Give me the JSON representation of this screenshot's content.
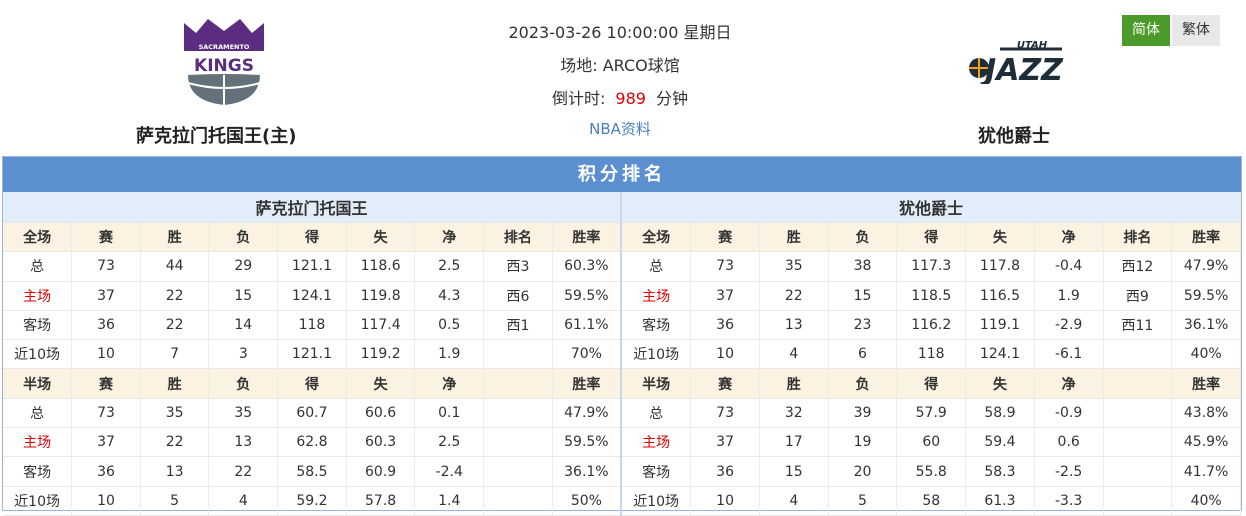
{
  "match": {
    "datetime": "2023-03-26 10:00:00 星期日",
    "venue_label": "场地:",
    "venue": "ARCO球馆",
    "countdown_label": "倒计时:",
    "countdown_value": "989",
    "countdown_unit": "分钟",
    "info_link": "NBA资料"
  },
  "home": {
    "name": "萨克拉门托国王(主)",
    "logo_text_top": "SACRAMENTO",
    "logo_text_main": "KINGS"
  },
  "away": {
    "name": "犹他爵士",
    "logo_text_top": "UTAH",
    "logo_text_main": "JAZZ"
  },
  "lang": {
    "simplified": "简体",
    "traditional": "繁体"
  },
  "panel_title": "积分排名",
  "tables": [
    {
      "team": "萨克拉门托国王",
      "rows": [
        [
          "全场",
          "赛",
          "胜",
          "负",
          "得",
          "失",
          "净",
          "排名",
          "胜率"
        ],
        [
          "总",
          "73",
          "44",
          "29",
          "121.1",
          "118.6",
          "2.5",
          "西3",
          "60.3%"
        ],
        [
          "主场",
          "37",
          "22",
          "15",
          "124.1",
          "119.8",
          "4.3",
          "西6",
          "59.5%"
        ],
        [
          "客场",
          "36",
          "22",
          "14",
          "118",
          "117.4",
          "0.5",
          "西1",
          "61.1%"
        ],
        [
          "近10场",
          "10",
          "7",
          "3",
          "121.1",
          "119.2",
          "1.9",
          "",
          "70%"
        ],
        [
          "半场",
          "赛",
          "胜",
          "负",
          "得",
          "失",
          "净",
          "",
          "胜率"
        ],
        [
          "总",
          "73",
          "35",
          "35",
          "60.7",
          "60.6",
          "0.1",
          "",
          "47.9%"
        ],
        [
          "主场",
          "37",
          "22",
          "13",
          "62.8",
          "60.3",
          "2.5",
          "",
          "59.5%"
        ],
        [
          "客场",
          "36",
          "13",
          "22",
          "58.5",
          "60.9",
          "-2.4",
          "",
          "36.1%"
        ],
        [
          "近10场",
          "10",
          "5",
          "4",
          "59.2",
          "57.8",
          "1.4",
          "",
          "50%"
        ]
      ]
    },
    {
      "team": "犹他爵士",
      "rows": [
        [
          "全场",
          "赛",
          "胜",
          "负",
          "得",
          "失",
          "净",
          "排名",
          "胜率"
        ],
        [
          "总",
          "73",
          "35",
          "38",
          "117.3",
          "117.8",
          "-0.4",
          "西12",
          "47.9%"
        ],
        [
          "主场",
          "37",
          "22",
          "15",
          "118.5",
          "116.5",
          "1.9",
          "西9",
          "59.5%"
        ],
        [
          "客场",
          "36",
          "13",
          "23",
          "116.2",
          "119.1",
          "-2.9",
          "西11",
          "36.1%"
        ],
        [
          "近10场",
          "10",
          "4",
          "6",
          "118",
          "124.1",
          "-6.1",
          "",
          "40%"
        ],
        [
          "半场",
          "赛",
          "胜",
          "负",
          "得",
          "失",
          "净",
          "",
          "胜率"
        ],
        [
          "总",
          "73",
          "32",
          "39",
          "57.9",
          "58.9",
          "-0.9",
          "",
          "43.8%"
        ],
        [
          "主场",
          "37",
          "17",
          "19",
          "60",
          "59.4",
          "0.6",
          "",
          "45.9%"
        ],
        [
          "客场",
          "36",
          "15",
          "20",
          "55.8",
          "58.3",
          "-2.5",
          "",
          "41.7%"
        ],
        [
          "近10场",
          "10",
          "4",
          "5",
          "58",
          "61.3",
          "-3.3",
          "",
          "40%"
        ]
      ]
    }
  ],
  "colors": {
    "header_bar": "#5b8fcf",
    "team_row": "#e3edf9",
    "hdr_row": "#fbf2e2",
    "home_red": "#e00000",
    "lang_active": "#4c9a2a"
  }
}
